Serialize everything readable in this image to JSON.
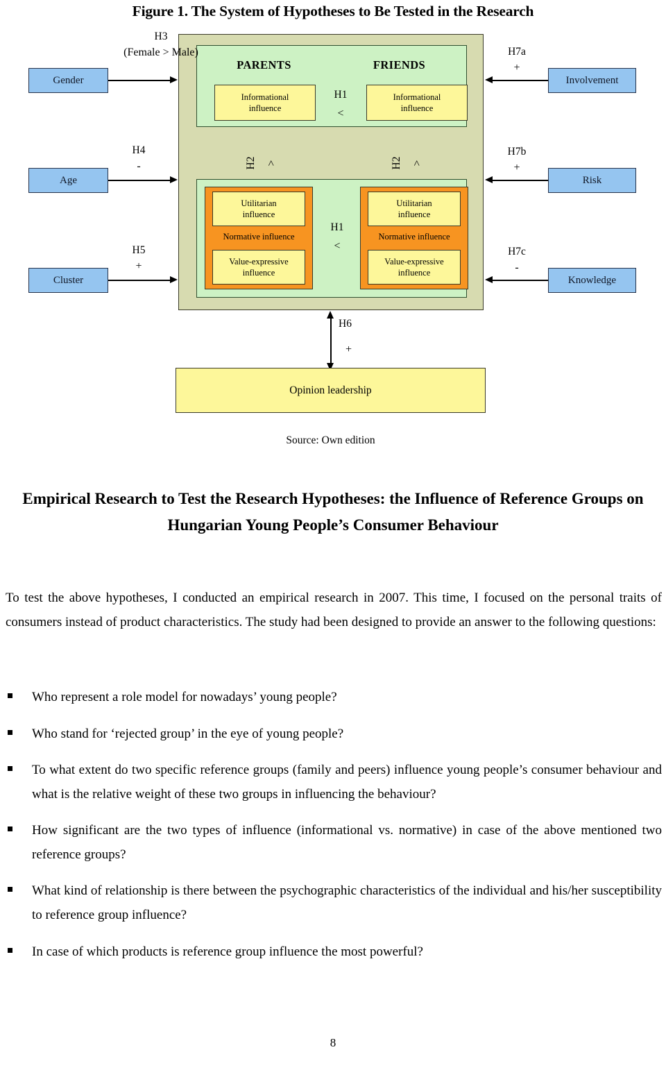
{
  "figure": {
    "title": "Figure 1. The System of Hypotheses to Be Tested in the Research",
    "source": "Source: Own edition",
    "outer_color": "#d7dbb0",
    "panel_color": "#cdf2c4",
    "yellow_color": "#fdf79a",
    "orange_color": "#f79421",
    "blue_color": "#95c5f0",
    "groups": [
      {
        "name": "PARENTS"
      },
      {
        "name": "FRIENDS"
      }
    ],
    "informational": {
      "parents": "Informational\ninfluence",
      "friends": "Informational\ninfluence",
      "line1": "Informational",
      "line2": "influence"
    },
    "normative": {
      "label": "Normative influence",
      "utilitarian_line1": "Utilitarian",
      "utilitarian_line2": "influence",
      "value_line1": "Value-expressive",
      "value_line2": "influence"
    },
    "comparisons": [
      {
        "id": "h1-top",
        "label": "H1",
        "operator": "<"
      },
      {
        "id": "h1-bottom",
        "label": "H1",
        "operator": "<"
      },
      {
        "id": "h2-parents",
        "label": "H2",
        "operator": ">"
      },
      {
        "id": "h2-friends",
        "label": "H2",
        "operator": ">"
      }
    ],
    "left_constructs": [
      {
        "name": "Gender",
        "hypothesis": "H3",
        "sign": "(Female > Male)"
      },
      {
        "name": "Age",
        "hypothesis": "H4",
        "sign": "-"
      },
      {
        "name": "Cluster",
        "hypothesis": "H5",
        "sign": "+"
      }
    ],
    "right_constructs": [
      {
        "name": "Involvement",
        "hypothesis": "H7a",
        "sign": "+"
      },
      {
        "name": "Risk",
        "hypothesis": "H7b",
        "sign": "+"
      },
      {
        "name": "Knowledge",
        "hypothesis": "H7c",
        "sign": "-"
      }
    ],
    "bottom_construct": {
      "name": "Opinion leadership",
      "hypothesis": "H6",
      "sign": "+"
    }
  },
  "body": {
    "heading": "Empirical Research to Test the Research Hypotheses: the Influence of Reference Groups on Hungarian Young People’s Consumer Behaviour",
    "intro": "To test the above hypotheses, I conducted an empirical research in 2007. This time, I focused on the personal traits of consumers instead of product characteristics. The study had been designed to provide an answer to the following questions:",
    "questions": [
      "Who represent a role model for nowadays’ young people?",
      "Who stand for ‘rejected group’ in the eye of young people?",
      "To what extent do two specific reference groups (family and peers) influence young people’s consumer behaviour and what is the relative weight of these two groups in influencing the behaviour?",
      "How significant are the two types of influence (informational vs. normative) in case of the above mentioned two reference groups?",
      "What kind of relationship is there between the psychographic characteristics of the individual and his/her susceptibility to reference group influence?",
      "In case of which products is reference group influence the most powerful?"
    ]
  },
  "page": {
    "number": "8"
  }
}
